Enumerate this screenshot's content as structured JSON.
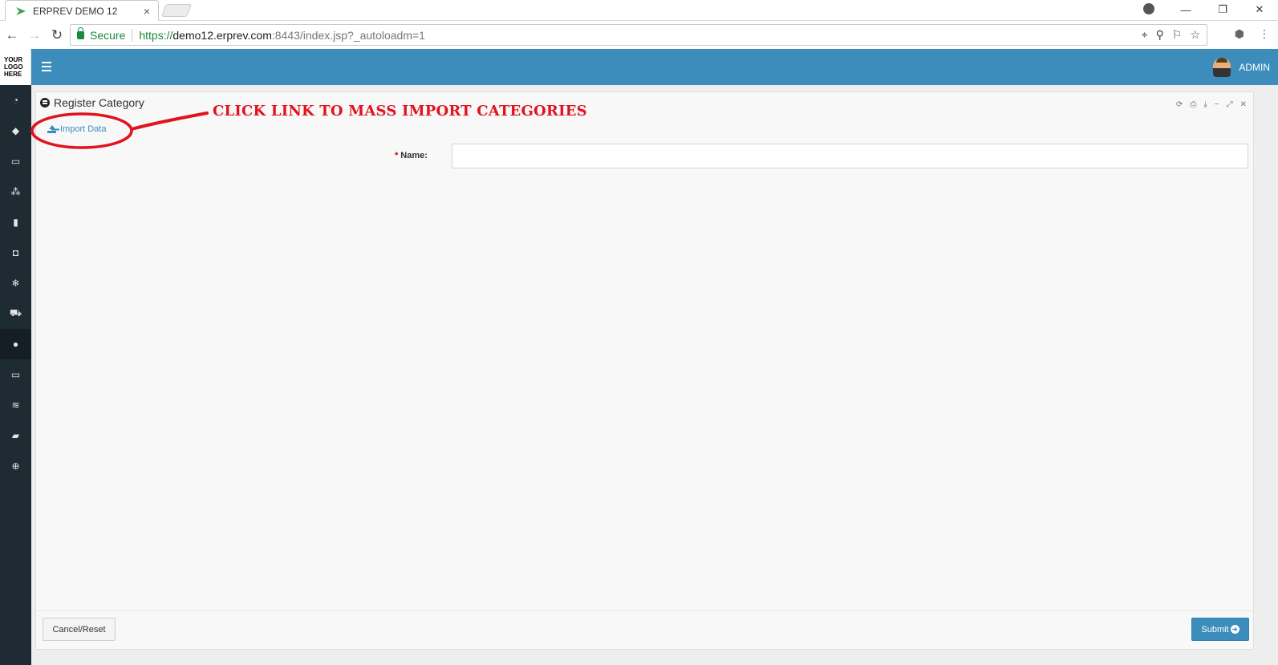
{
  "browser": {
    "tab_title": "ERPREV DEMO 12",
    "tab_close": "×",
    "window_controls": {
      "minimize": "—",
      "restore": "❐",
      "close": "✕"
    },
    "nav": {
      "back": "←",
      "forward": "→",
      "reload": "↻"
    },
    "secure_label": "Secure",
    "url": {
      "scheme": "https://",
      "host": "demo12.erprev.com",
      "rest": ":8443/index.jsp?_autoloadm=1"
    },
    "omnibox_icons": [
      "target-icon",
      "zoom-icon",
      "pin-icon",
      "star-icon"
    ],
    "menu": "⋮"
  },
  "logo": {
    "line1": "YOUR",
    "line2": "LOGO",
    "line3": "HERE"
  },
  "sidebar": {
    "items": [
      {
        "icon": "dashboard-icon",
        "glyph": "◔"
      },
      {
        "icon": "tag-icon",
        "glyph": "◆"
      },
      {
        "icon": "money-icon",
        "glyph": "▭"
      },
      {
        "icon": "cubes-icon",
        "glyph": "⁂"
      },
      {
        "icon": "building-icon",
        "glyph": "▮"
      },
      {
        "icon": "trash-icon",
        "glyph": "◘"
      },
      {
        "icon": "snowflake-icon",
        "glyph": "❄"
      },
      {
        "icon": "cart-icon",
        "glyph": "⛟"
      },
      {
        "icon": "category-icon",
        "glyph": "●",
        "active": true
      },
      {
        "icon": "monitor-icon",
        "glyph": "▭"
      },
      {
        "icon": "database-icon",
        "glyph": "≋"
      },
      {
        "icon": "book-icon",
        "glyph": "▰"
      },
      {
        "icon": "lifebuoy-icon",
        "glyph": "⊕"
      }
    ]
  },
  "topbar": {
    "user_label": "ADMIN"
  },
  "panel": {
    "title": "Register Category",
    "tools": [
      "⟳",
      "⎙",
      "⤓",
      "−",
      "⤢",
      "✕"
    ],
    "import_link": "Import Data",
    "name_label": "Name:",
    "name_required": "*",
    "name_value": "",
    "cancel_label": "Cancel/Reset",
    "submit_label": "Submit"
  },
  "annotation": {
    "text": "CLICK LINK TO MASS IMPORT CATEGORIES",
    "color": "#e0141e"
  },
  "colors": {
    "primary": "#3c8dbc",
    "sidebar": "#1e2b33",
    "annotation": "#e0141e"
  }
}
